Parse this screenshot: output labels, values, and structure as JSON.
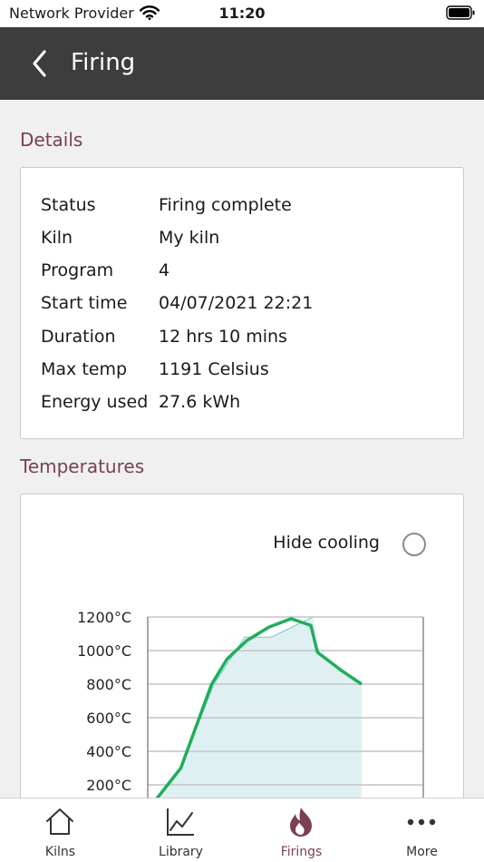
{
  "status_bar": {
    "carrier": "Network Provider",
    "time": "11:20"
  },
  "nav": {
    "title": "Firing",
    "back_icon": "chevron-left-icon"
  },
  "details": {
    "section_title": "Details",
    "rows": [
      {
        "label": "Status",
        "value": "Firing complete"
      },
      {
        "label": "Kiln",
        "value": "My kiln"
      },
      {
        "label": "Program",
        "value": "4"
      },
      {
        "label": "Start time",
        "value": "04/07/2021 22:21"
      },
      {
        "label": "Duration",
        "value": "12 hrs 10 mins"
      },
      {
        "label": "Max temp",
        "value": "1191 Celsius"
      },
      {
        "label": "Energy used",
        "value": "27.6 kWh"
      }
    ]
  },
  "temperatures": {
    "section_title": "Temperatures",
    "hide_cooling_label": "Hide cooling",
    "hide_cooling_on": false
  },
  "chart_data": {
    "type": "line",
    "y_tick_labels": [
      "200°C",
      "400°C",
      "600°C",
      "800°C",
      "1000°C",
      "1200°C"
    ],
    "y_ticks": [
      200,
      400,
      600,
      800,
      1000,
      1200
    ],
    "ylim": [
      0,
      1200
    ],
    "xlim": [
      0,
      12.5
    ],
    "grid": true,
    "series": [
      {
        "style": "actual",
        "color": "#1fae5a",
        "x": [
          0,
          0.3,
          1.5,
          2.9,
          3.6,
          4.5,
          5.5,
          6.5,
          7.4,
          7.7,
          8.8,
          9.7
        ],
        "y": [
          0,
          100,
          300,
          800,
          950,
          1060,
          1140,
          1190,
          1150,
          990,
          880,
          800
        ]
      },
      {
        "style": "program",
        "color": "#7cc6d2",
        "fill": "#dff0f3",
        "x": [
          0,
          0.3,
          1.5,
          3.0,
          4.4,
          5.6,
          7.5
        ],
        "y": [
          0,
          100,
          300,
          800,
          1080,
          1080,
          1200
        ]
      }
    ]
  },
  "tabs": [
    {
      "label": "Kilns",
      "icon": "home-icon",
      "active": false
    },
    {
      "label": "Library",
      "icon": "line-chart-icon",
      "active": false
    },
    {
      "label": "Firings",
      "icon": "flame-icon",
      "active": true
    },
    {
      "label": "More",
      "icon": "more-dots-icon",
      "active": false
    }
  ],
  "colors": {
    "accent": "#7a3f55",
    "nav_bg": "#3d3d3d",
    "line": "#1fae5a",
    "area": "#dff0f3"
  }
}
